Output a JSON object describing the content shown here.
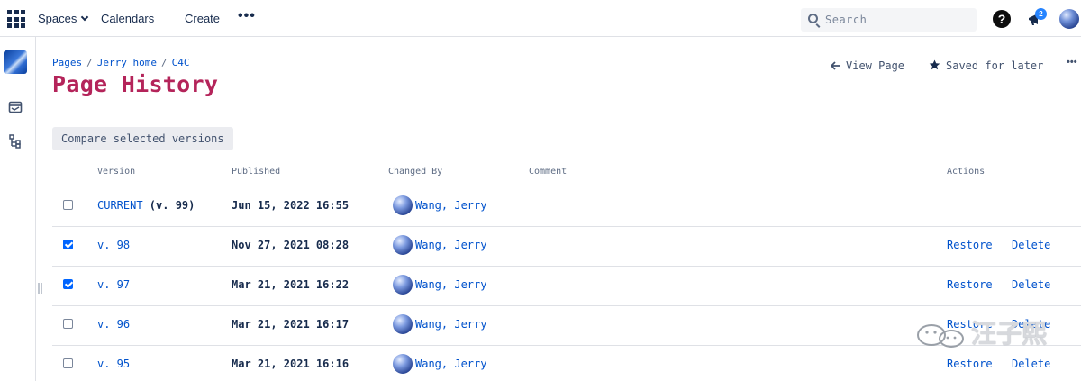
{
  "topbar": {
    "spaces_label": "Spaces",
    "calendars_label": "Calendars",
    "create_label": "Create",
    "more_label": "•••",
    "search_placeholder": "Search",
    "help_label": "?",
    "notification_count": "2"
  },
  "breadcrumb": {
    "items": [
      "Pages",
      "Jerry_home",
      "C4C"
    ],
    "separator": "/"
  },
  "page": {
    "title": "Page History",
    "view_page_label": "View Page",
    "saved_label": "Saved for later",
    "more_label": "•••"
  },
  "compare_button_label": "Compare selected versions",
  "table": {
    "headers": {
      "version": "Version",
      "published": "Published",
      "changed_by": "Changed By",
      "comment": "Comment",
      "actions": "Actions"
    },
    "rows": [
      {
        "version_link": "CURRENT",
        "version_suffix": " (v. 99)",
        "published": "Jun 15, 2022 16:55",
        "changed_by": "Wang, Jerry",
        "checked": false,
        "restore": "",
        "delete": ""
      },
      {
        "version_link": "v. 98",
        "version_suffix": "",
        "published": "Nov 27, 2021 08:28",
        "changed_by": "Wang, Jerry",
        "checked": true,
        "restore": "Restore",
        "delete": "Delete"
      },
      {
        "version_link": "v. 97",
        "version_suffix": "",
        "published": "Mar 21, 2021 16:22",
        "changed_by": "Wang, Jerry",
        "checked": true,
        "restore": "Restore",
        "delete": "Delete"
      },
      {
        "version_link": "v. 96",
        "version_suffix": "",
        "published": "Mar 21, 2021 16:17",
        "changed_by": "Wang, Jerry",
        "checked": false,
        "restore": "Restore",
        "delete": "Delete"
      },
      {
        "version_link": "v. 95",
        "version_suffix": "",
        "published": "Mar 21, 2021 16:16",
        "changed_by": "Wang, Jerry",
        "checked": false,
        "restore": "Restore",
        "delete": "Delete"
      }
    ]
  },
  "watermark": {
    "text": "汪子熙",
    "icon": "wechat-icon"
  },
  "colors": {
    "title": "#b4245a",
    "link": "#0052cc",
    "checkbox": "#0065ff"
  }
}
